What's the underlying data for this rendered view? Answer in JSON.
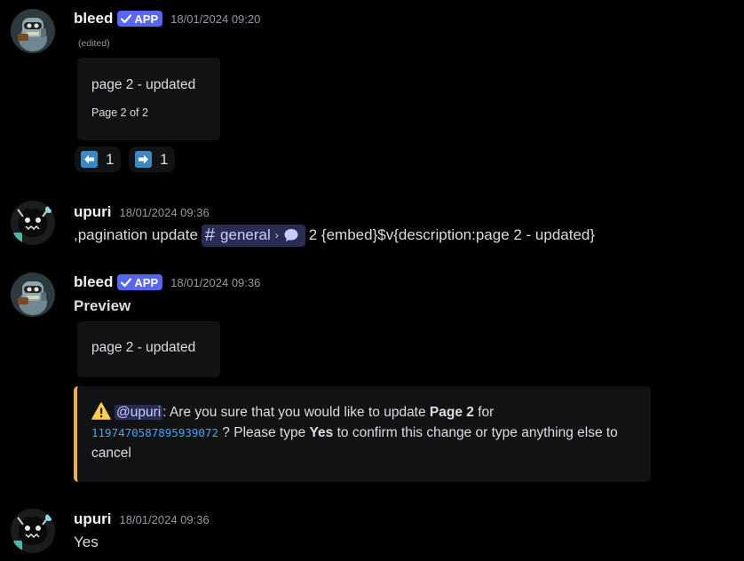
{
  "messages": [
    {
      "username": "bleed",
      "app_badge": "APP",
      "timestamp": "18/01/2024 09:20",
      "edited": "(edited)",
      "embed": {
        "description": "page 2 - updated",
        "footer": "Page 2 of 2"
      },
      "reactions": [
        {
          "icon": "arrow-left-emoji",
          "count": "1"
        },
        {
          "icon": "arrow-right-emoji",
          "count": "1"
        }
      ]
    },
    {
      "username": "upuri",
      "timestamp": "18/01/2024 09:36",
      "content_prefix": ",pagination update",
      "channel_mention": "general",
      "content_suffix": "2 {embed}$v{description:page 2 - updated}"
    },
    {
      "username": "bleed",
      "app_badge": "APP",
      "timestamp": "18/01/2024 09:36",
      "title": "Preview",
      "embed": {
        "description": "page 2 - updated"
      },
      "warning": {
        "icon": "warning-icon",
        "mention": "@upuri",
        "text1": ": Are you sure that you would like to update ",
        "bold1": "Page 2",
        "text2": " for",
        "message_id": "1197470587895939072",
        "text3": " ? Please type ",
        "bold2": "Yes",
        "text4": " to confirm this change or type anything else to cancel",
        "accent_color": "#f0b232"
      }
    },
    {
      "username": "upuri",
      "timestamp": "18/01/2024 09:36",
      "content": "Yes"
    }
  ],
  "colors": {
    "background": "#000000",
    "embed_bg": "#111214",
    "app_badge": "#5865f2",
    "mention_bg": "#2a2d53",
    "link": "#3ea6ff"
  }
}
